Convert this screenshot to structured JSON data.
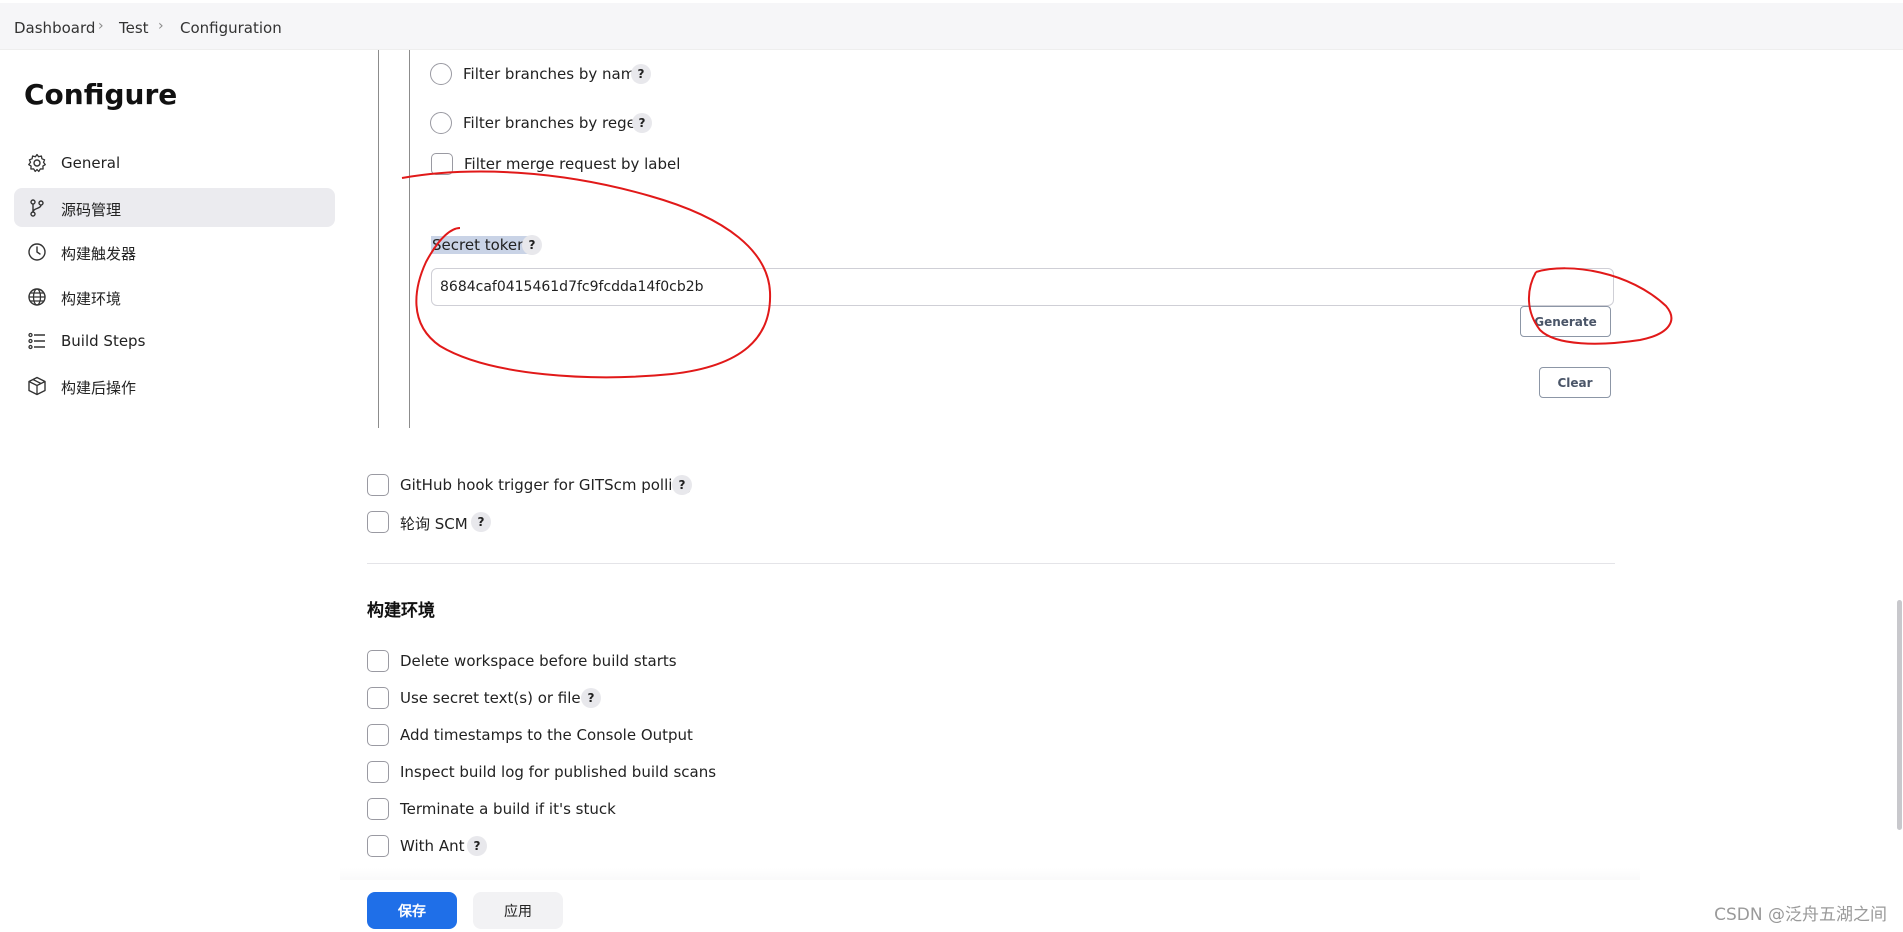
{
  "breadcrumb": [
    "Dashboard",
    "Test",
    "Configuration"
  ],
  "sidebar": {
    "title": "Configure",
    "items": [
      {
        "label": "General",
        "icon": "gear-icon"
      },
      {
        "label": "源码管理",
        "icon": "branch-icon",
        "active": true
      },
      {
        "label": "构建触发器",
        "icon": "clock-icon"
      },
      {
        "label": "构建环境",
        "icon": "globe-icon"
      },
      {
        "label": "Build Steps",
        "icon": "list-icon"
      },
      {
        "label": "构建后操作",
        "icon": "cube-icon"
      }
    ]
  },
  "gitlab_filters": [
    {
      "label": "Filter branches by name",
      "type": "radio",
      "help": "?"
    },
    {
      "label": "Filter branches by regex",
      "type": "radio",
      "help": "?"
    },
    {
      "label": "Filter merge request by label",
      "type": "checkbox"
    }
  ],
  "secret_token": {
    "label": "Secret token",
    "help": "?",
    "value": "8684caf0415461d7fc9fcdda14f0cb2b",
    "generate_label": "Generate",
    "clear_label": "Clear"
  },
  "triggers": [
    {
      "label": "GitHub hook trigger for GITScm polling",
      "help": "?"
    },
    {
      "label": "轮询 SCM",
      "help": "?"
    }
  ],
  "build_env": {
    "title": "构建环境",
    "options": [
      {
        "label": "Delete workspace before build starts"
      },
      {
        "label": "Use secret text(s) or file(s)",
        "help": "?"
      },
      {
        "label": "Add timestamps to the Console Output"
      },
      {
        "label": "Inspect build log for published build scans"
      },
      {
        "label": "Terminate a build if it's stuck"
      },
      {
        "label": "With Ant",
        "help": "?"
      }
    ]
  },
  "actions": {
    "save": "保存",
    "apply": "应用"
  },
  "watermark": "CSDN @泛舟五湖之间",
  "colors": {
    "primary": "#1f6fe8",
    "annotation": "#e11919",
    "sidebar_active": "#ebebef"
  }
}
